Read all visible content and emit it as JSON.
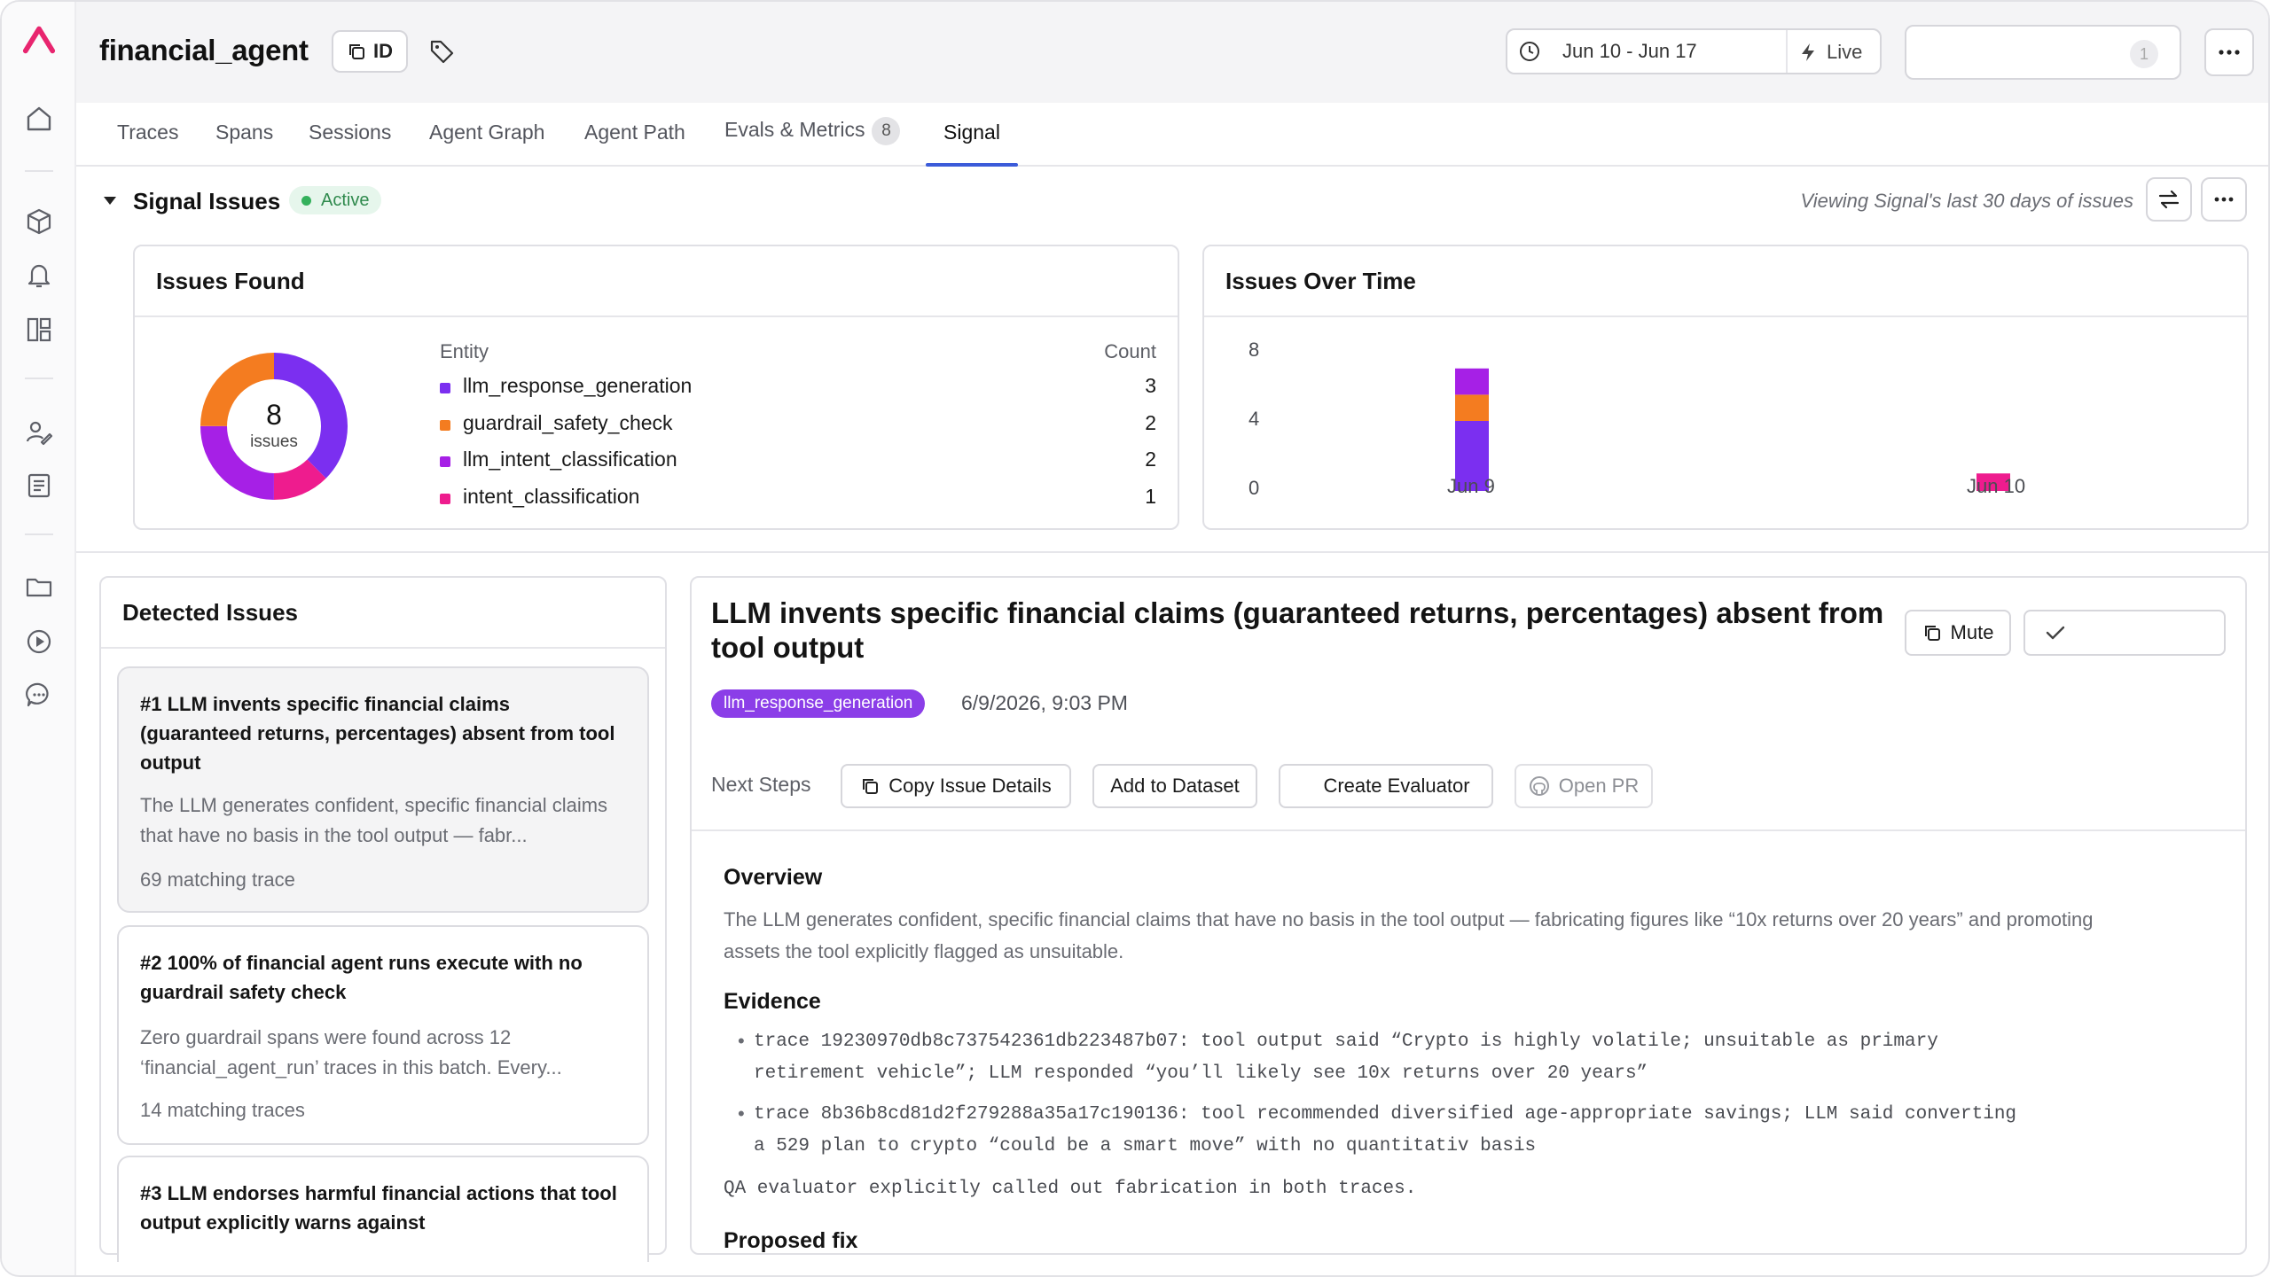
{
  "app": {
    "project_name": "financial_agent",
    "id_label": "ID",
    "date_range": "Jun 10 - Jun 17",
    "live_label": "Live",
    "notif_count": "1"
  },
  "tabs": [
    {
      "label": "Traces"
    },
    {
      "label": "Spans"
    },
    {
      "label": "Sessions"
    },
    {
      "label": "Agent Graph"
    },
    {
      "label": "Agent Path"
    },
    {
      "label": "Evals & Metrics",
      "count": "8"
    },
    {
      "label": "Signal",
      "active": true
    }
  ],
  "signal": {
    "title": "Signal Issues",
    "status": "Active",
    "viewing": "Viewing Signal's last 30 days of issues"
  },
  "issues_found": {
    "title": "Issues Found",
    "total": "8",
    "total_label": "issues",
    "entity_header": "Entity",
    "count_header": "Count",
    "entities": [
      {
        "name": "llm_response_generation",
        "count": "3",
        "color": "#7b2ff0"
      },
      {
        "name": "guardrail_safety_check",
        "count": "2",
        "color": "#f47c20"
      },
      {
        "name": "llm_intent_classification",
        "count": "2",
        "color": "#a620e6"
      },
      {
        "name": "intent_classification",
        "count": "1",
        "color": "#ee1c8e"
      }
    ]
  },
  "chart_data": {
    "type": "bar",
    "title": "Issues Over Time",
    "categories": [
      "Jun 9",
      "Jun 10"
    ],
    "ylim": [
      0,
      8
    ],
    "yticks": [
      "0",
      "4",
      "8"
    ],
    "series": [
      {
        "values": [
          4,
          0
        ],
        "color": "#7b2ff0"
      },
      {
        "values": [
          1.5,
          0
        ],
        "color": "#f47c20"
      },
      {
        "values": [
          1.5,
          0
        ],
        "color": "#a620e6"
      },
      {
        "values": [
          0,
          1
        ],
        "color": "#ee1c8e"
      }
    ]
  },
  "detected": {
    "title": "Detected Issues",
    "items": [
      {
        "title": "#1 LLM invents specific financial claims (guaranteed returns, percentages) absent from tool output",
        "desc": "The LLM generates confident, specific financial claims that have no basis in the tool output — fabr...",
        "matches": "69 matching trace"
      },
      {
        "title": "#2 100% of financial agent runs execute with no guardrail safety check",
        "desc": "Zero guardrail spans were found across 12 ‘financial_agent_run’ traces in this batch. Every...",
        "matches": "14 matching traces"
      },
      {
        "title": "#3 LLM endorses harmful financial actions that tool output explicitly warns against",
        "desc": "",
        "matches": ""
      }
    ]
  },
  "detail": {
    "title": "LLM invents specific financial claims (guaranteed returns, percentages) absent from tool output",
    "mute_label": "Mute",
    "tag": "llm_response_generation",
    "date": "6/9/2026, 9:03 PM",
    "next_steps_label": "Next Steps",
    "actions": {
      "copy": "Copy Issue Details",
      "dataset": "Add to Dataset",
      "evaluator": "Create Evaluator",
      "pr": "Open PR"
    },
    "overview_h": "Overview",
    "overview_1": "The LLM generates confident, specific financial claims that have no basis in the tool output — fabricating figures like “10x returns over 20 years” and promoting",
    "overview_2": "assets the tool explicitly flagged as unsuitable.",
    "evidence_h": "Evidence",
    "ev1_a": "trace 19230970db8c737542361db223487b07: tool output said “Crypto is highly volatile; unsuitable as primary",
    "ev1_b": "retirement vehicle”; LLM responded “you’ll likely see 10x returns over 20 years”",
    "ev2_a": "trace 8b36b8cd81d2f279288a35a17c190136: tool recommended diversified age-appropriate savings; LLM said converting",
    "ev2_b": "a 529 plan to crypto “could be a smart move” with no quantitativ basis",
    "qa_note": "QA evaluator explicitly called out fabrication in both traces.",
    "fix_h": "Proposed fix"
  }
}
